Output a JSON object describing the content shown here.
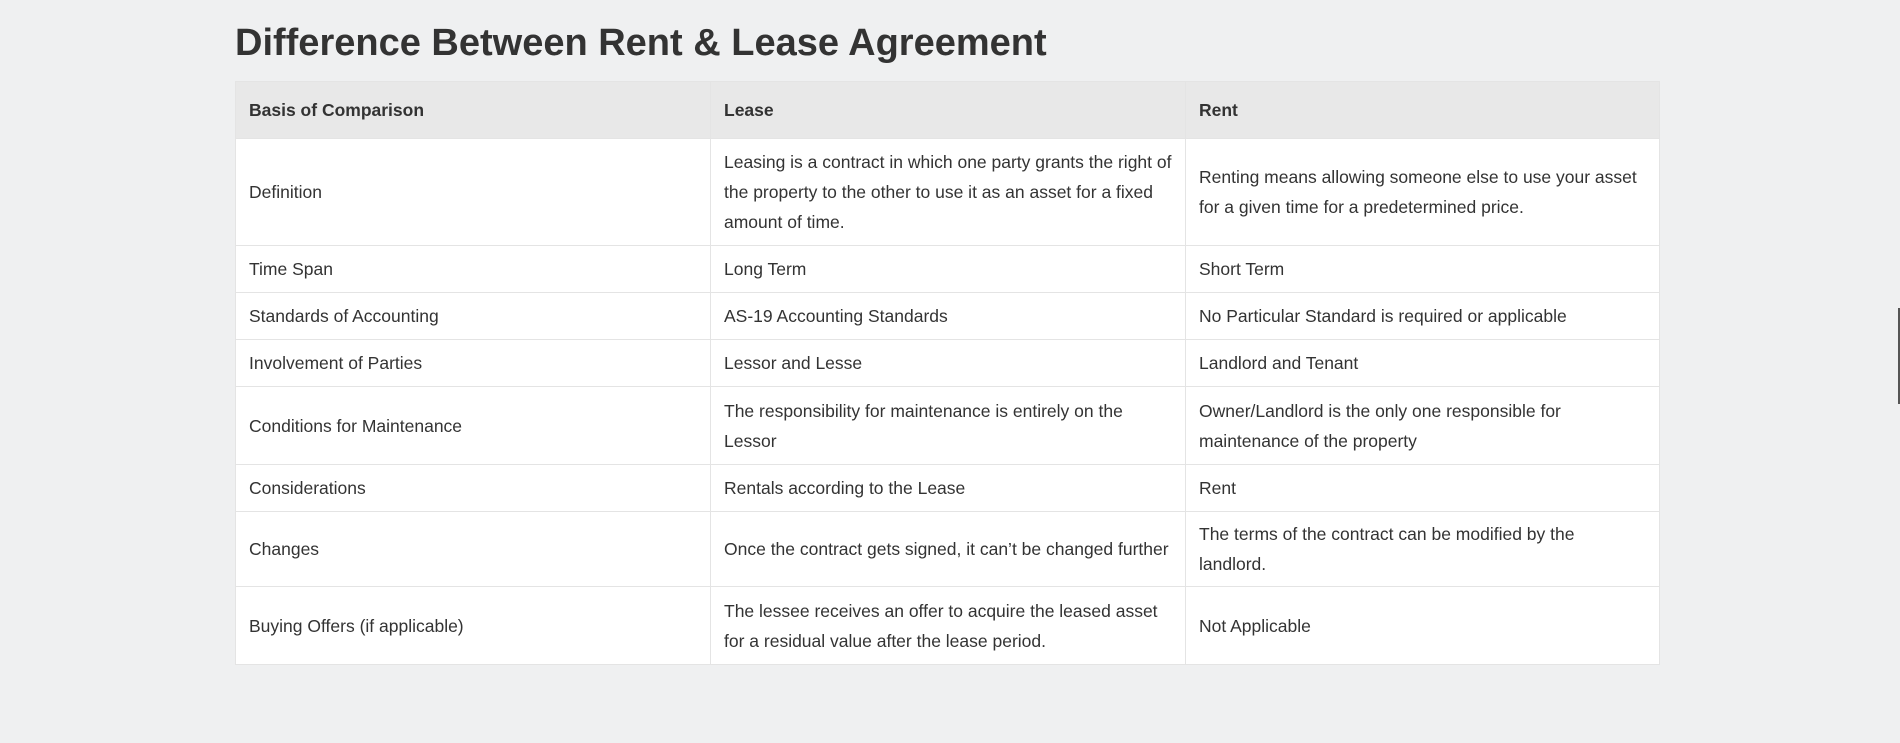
{
  "page": {
    "title": "Difference Between Rent & Lease Agreement"
  },
  "table": {
    "headers": [
      "Basis of Comparison",
      "Lease",
      "Rent"
    ],
    "rows": [
      {
        "basis": "Definition",
        "lease": "Leasing is a contract in which one party grants the right of the property to the other to use it as an asset for a fixed amount of time.",
        "rent": "Renting means allowing someone else to use your asset for a given time for a predetermined price."
      },
      {
        "basis": "Time Span",
        "lease": "Long Term",
        "rent": "Short Term"
      },
      {
        "basis": "Standards of Accounting",
        "lease": "AS-19 Accounting Standards",
        "rent": "No Particular Standard is required or applicable"
      },
      {
        "basis": "Involvement of Parties",
        "lease": "Lessor and Lesse",
        "rent": "Landlord and Tenant"
      },
      {
        "basis": "Conditions for Maintenance",
        "lease": "The responsibility for maintenance is entirely on the Lessor",
        "rent": "Owner/Landlord is the only one responsible for maintenance of the property"
      },
      {
        "basis": "Considerations",
        "lease": "Rentals according to the Lease",
        "rent": "Rent"
      },
      {
        "basis": "Changes",
        "lease": "Once the contract gets signed, it can’t be changed further",
        "rent": "The terms of the contract can be modified by the landlord."
      },
      {
        "basis": "Buying Offers (if applicable)",
        "lease": "The lessee receives an offer to acquire the leased asset for a residual value after the lease period.",
        "rent": "Not Applicable"
      }
    ]
  },
  "colors": {
    "background": "#eff0f1",
    "header_bg": "#e8e8e8",
    "cell_bg": "#ffffff",
    "border": "#e4e4e4",
    "text": "#333333"
  }
}
